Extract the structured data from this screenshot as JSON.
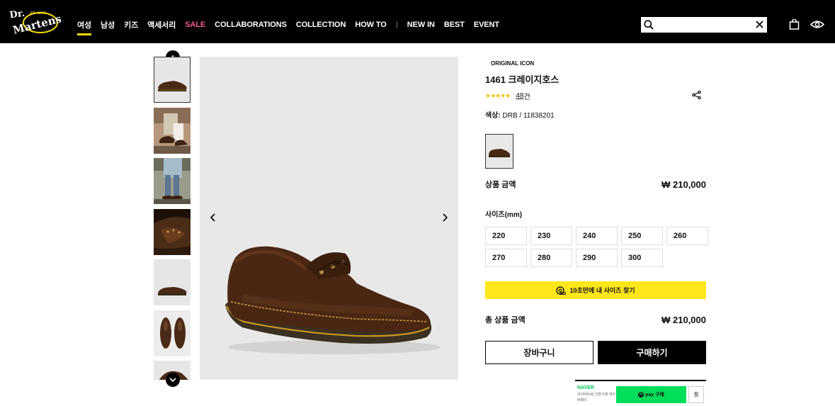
{
  "header": {
    "logo_text": "Dr. Martens",
    "nav": [
      {
        "label": "여성",
        "active": true
      },
      {
        "label": "남성"
      },
      {
        "label": "키즈"
      },
      {
        "label": "액세서리"
      },
      {
        "label": "SALE",
        "highlight": "#f25a8f"
      },
      {
        "label": "COLLABORATIONS"
      },
      {
        "label": "COLLECTION"
      },
      {
        "label": "HOW TO"
      },
      {
        "label": "NEW IN"
      },
      {
        "label": "BEST"
      },
      {
        "label": "EVENT"
      }
    ],
    "search": {
      "value": "",
      "placeholder": ""
    },
    "icons": [
      "search-icon",
      "close-icon",
      "shopping-bag-icon",
      "eye-icon"
    ]
  },
  "gallery": {
    "thumbnails": [
      "shoe-side",
      "lifestyle-sitting",
      "lifestyle-standing",
      "shoe-closeup",
      "shoe-side-small",
      "shoe-top-pair",
      "shoe-partial"
    ],
    "selected_index": 0
  },
  "product": {
    "badge": "ORIGINAL ICON",
    "name": "1461 크레이지호스",
    "stars": "★★★★★",
    "rating": 4.5,
    "review_count": "48",
    "review_unit": " 건",
    "color_label": "색상:",
    "color_value": " DRB / 11838201",
    "price_label": "상품 금액",
    "price": "₩ 210,000",
    "size_label": "사이즈(mm)",
    "sizes": [
      "220",
      "230",
      "240",
      "250",
      "260",
      "270",
      "280",
      "290",
      "300"
    ],
    "find_size_label": "10초만에 내 사이즈 찾기",
    "total_label": "총 상품 금액",
    "total_price": "₩ 210,000",
    "cart_label": "장바구니",
    "buy_label": "구매하기"
  },
  "naver_pay": {
    "brand": "NAVER",
    "sub": "네이버ID로 간편구매 네이버페이",
    "button_label": "pay 구매",
    "wish_label": "찜"
  },
  "colors": {
    "header_bg": "#000000",
    "accent_yellow": "#ffe71b",
    "sale_pink": "#f25a8f",
    "npay_green": "#00de5a"
  }
}
